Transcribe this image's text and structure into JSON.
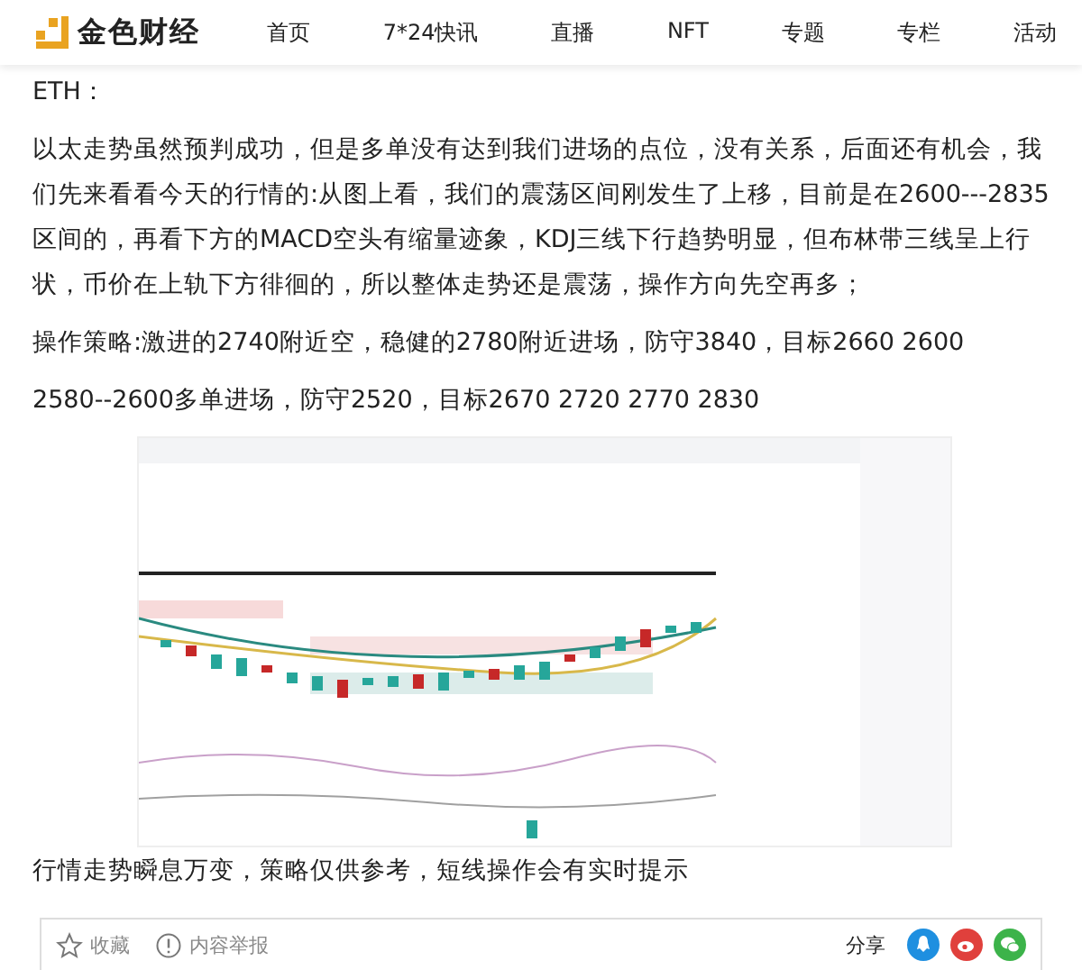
{
  "header": {
    "logo_text": "金色财经",
    "nav": [
      {
        "label": "首页"
      },
      {
        "label": "7*24快讯"
      },
      {
        "label": "直播"
      },
      {
        "label": "NFT"
      },
      {
        "label": "专题"
      },
      {
        "label": "专栏"
      },
      {
        "label": "活动"
      }
    ]
  },
  "article": {
    "paragraphs": [
      "ETH：",
      "以太走势虽然预判成功，但是多单没有达到我们进场的点位，没有关系，后面还有机会，我们先来看看今天的行情的:从图上看，我们的震荡区间刚发生了上移，目前是在2600---2835区间的，再看下方的MACD空头有缩量迹象，KDJ三线下行趋势明显，但布林带三线呈上行状，币价在上轨下方徘徊的，所以整体走势还是震荡，操作方向先空再多；",
      "操作策略:激进的2740附近空，稳健的2780附近进场，防守3840，目标2660   2600",
      "2580--2600多单进场，防守2520，目标2670   2720  2770  2830"
    ],
    "after_text": "行情走势瞬息万变，策略仅供参考，短线操作会有实时提示"
  },
  "footer": {
    "actions": [
      {
        "label": "收藏"
      },
      {
        "label": "内容举报"
      }
    ],
    "share_label": "分享",
    "share": [
      {
        "color": "#1e8fe0"
      },
      {
        "color": "#e0403c"
      },
      {
        "color": "#3cb34a"
      }
    ]
  }
}
